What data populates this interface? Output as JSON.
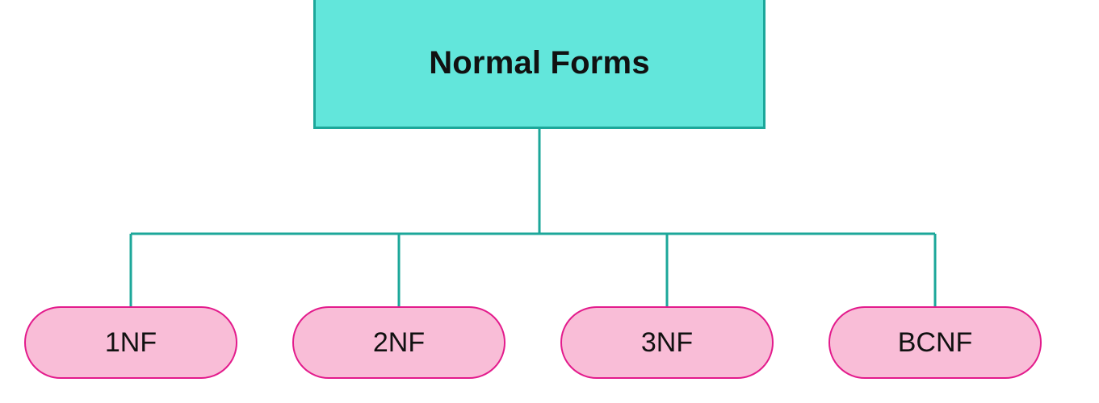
{
  "root": {
    "label": "Normal Forms",
    "fill": "#62E6DB",
    "border": "#1CA79A"
  },
  "children": [
    {
      "label": "1NF",
      "fill": "#F9BDD7",
      "border": "#E31B8C"
    },
    {
      "label": "2NF",
      "fill": "#F9BDD7",
      "border": "#E31B8C"
    },
    {
      "label": "3NF",
      "fill": "#F9BDD7",
      "border": "#E31B8C"
    },
    {
      "label": "BCNF",
      "fill": "#F9BDD7",
      "border": "#E31B8C"
    }
  ],
  "connector_color": "#1CA79A"
}
